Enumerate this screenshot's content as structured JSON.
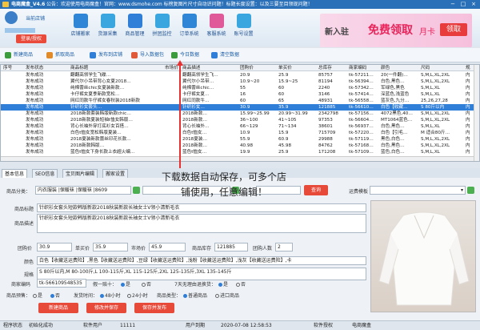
{
  "window": {
    "title": "电商魔盒_V4.6",
    "notice": "公告：欢迎使用电商魔盒！官网：www.dsmohe.com 标榜复图片尺寸自动识问题！标题长度设置：以及三要至目领现问题！",
    "controls": [
      "−",
      "□",
      "×"
    ]
  },
  "header": {
    "user_label": "当前店铺",
    "login_label": "登录/授权",
    "nav": [
      {
        "label": "店铺搬家",
        "icon": "shop-move-icon",
        "color": "#2f86d6"
      },
      {
        "label": "货源采集",
        "icon": "collect-icon",
        "color": "#3aa6e0"
      },
      {
        "label": "商品管理",
        "icon": "goods-icon",
        "color": "#2f7ed8"
      },
      {
        "label": "拼团监控",
        "icon": "monitor-icon",
        "color": "#3aa6e0"
      },
      {
        "label": "订单系统",
        "icon": "order-icon",
        "color": "#2f86d6"
      },
      {
        "label": "客服系统",
        "icon": "service-icon",
        "color": "#e05a9a"
      },
      {
        "label": "账号设置",
        "icon": "settings-icon",
        "color": "#3aa6e0"
      }
    ],
    "banner": {
      "prefix": "新入驻",
      "main": "免费领取",
      "suffix": "月卡",
      "button": "领取"
    }
  },
  "toolbar": [
    {
      "label": "新建商品",
      "icon": "add-icon",
      "color": "#3c9b3c"
    },
    {
      "label": "抓取商品",
      "icon": "grab-icon",
      "color": "#e08a2a"
    },
    {
      "label": "发布到店铺",
      "icon": "publish-icon",
      "color": "#2f7ed8"
    },
    {
      "label": "导入数据包",
      "icon": "import-icon",
      "color": "#e05a3a"
    },
    {
      "label": "今日数据",
      "icon": "today-icon",
      "color": "#3c9b3c"
    },
    {
      "label": "清空数据",
      "icon": "clear-icon",
      "color": "#2f7ed8"
    }
  ],
  "grid": {
    "columns": [
      "序号",
      "发布状态",
      "商品标题",
      "市场价",
      "商品描述",
      "团购价",
      "单买价",
      "总库存",
      "商家编码",
      "颜色",
      "尺码",
      "规"
    ],
    "rows": [
      [
        "",
        "发布成功",
        "翻翻高领学生飞碟…",
        "",
        "翻翻高领学生飞…",
        "20.9",
        "25.9",
        "85757",
        "tk-57211…",
        "20(一件翻)…",
        "S,M,L,XL,2XL",
        "内"
      ],
      [
        "",
        "发布成功",
        "翼代尔小吊带背心女夏2018…",
        "",
        "翼代尔小吊带…",
        "10.9~20",
        "15.9~25",
        "81194",
        "tk-56394…",
        "白色,黑色…",
        "S,M,L,XL,2XL",
        "内"
      ],
      [
        "",
        "发布成功",
        "纯棉蕾丝chic女夏装新款…",
        "",
        "纯棉蕾丝chic…",
        "55",
        "60",
        "2240",
        "tk-57342…",
        "军绿色,黑色",
        "S,M,L,XL",
        "内"
      ],
      [
        "",
        "发布成功",
        "卡仔裤女夏季新款宽松…",
        "",
        "卡仔裤女夏…",
        "16",
        "60",
        "3146",
        "tk-57414…",
        "深蓝色,浅蓝色",
        "S,M,L,XL",
        "内"
      ],
      [
        "",
        "发布成功",
        "网红同款牛仔裤女春秋装2018新款",
        "",
        "网红同款牛…",
        "60",
        "65",
        "48931",
        "tk-56558…",
        "蓝灰色,九分…",
        "25,26,27,28",
        "内"
      ],
      [
        "",
        "发布成功",
        "针织衫女套头…",
        "",
        "针织衫女…",
        "30.9",
        "35.9",
        "121885",
        "tk-56610…",
        "白色【收藏…",
        "S 80斤以内",
        "内"
      ],
      [
        "",
        "发布成功",
        "2018新款套装韩版新款chic…",
        "",
        "2018新款…",
        "15.99~25.99",
        "20.99~31.99",
        "2342798",
        "tk-57156…",
        "4072黑色,40…",
        "S,M,L,XL,2XL",
        "内"
      ],
      [
        "",
        "发布成功",
        "2018新款夏装短袖t恤女韩版…",
        "",
        "2018新款…",
        "36~100",
        "41~105",
        "97353",
        "tk-56604…",
        "MT1064蓝色…",
        "S,M,L,XL,2XL",
        "内"
      ],
      [
        "",
        "发布成功",
        "背心长袖外穿打底衫女百搭…",
        "",
        "背心长袖外…",
        "66~129",
        "71~134",
        "38601",
        "tk-56937…",
        "白色,黑色…",
        "S,M,L,XL",
        "内"
      ],
      [
        "",
        "发布成功",
        "白色t恤女宽松韩版夏装…",
        "",
        "白色t恤女…",
        "10.9",
        "15.9",
        "715709",
        "tk-57220…",
        "白色【引毛…",
        "M 适合80斤…",
        "内"
      ],
      [
        "",
        "发布成功",
        "2018夏装新款蕾丝印花长款…",
        "",
        "2018夏装…",
        "55.9",
        "60.9",
        "29988",
        "tk-57119…",
        "黑色,白色…",
        "S,M,L,XL,2XL",
        "内"
      ],
      [
        "",
        "发布成功",
        "2018新款韩版…",
        "",
        "2018新款…",
        "40.98",
        "45.98",
        "84762",
        "tk-57168…",
        "白色,黑色…",
        "S,M,L,XL,2XL",
        "内"
      ],
      [
        "",
        "发布成功",
        "蓝色t恤女下身长款上衣超火编…",
        "",
        "蓝色t恤女…",
        "19.9",
        "25.9",
        "171208",
        "tk-57109…",
        "蓝色,白色…",
        "S,M,L,XL",
        "内"
      ]
    ],
    "selected_index": 5
  },
  "tabs": [
    "基本信息",
    "SEO信息",
    "宝贝图片编辑",
    "搬家设置"
  ],
  "overlay_text": [
    "下载数据自动保存，可多个店",
    "铺使用，任意编辑！"
  ],
  "form": {
    "category_label": "商品分类：",
    "category_value": "内衣服装 |保暖袜 |保暖袜 |8609",
    "search_button": "查询",
    "template_label": "运费模板",
    "title_label": "商品标题",
    "title_value": "针织衫女套头短款韩版新款2018秋装新款长袖女士V领小清新毛衣",
    "desc_label": "商品描述",
    "desc_value": "针织衫女套头短款韩版新款2018秋装新款长袖女士V领小清新毛衣",
    "group_price_label": "团购价",
    "group_price": "30.9",
    "single_price_label": "单买价",
    "single_price": "35.9",
    "market_price_label": "市场价",
    "market_price": "45.9",
    "stock_label": "商品库存",
    "stock": "121885",
    "group_size_label": "团购人数",
    "group_size": "2",
    "color_label": "颜色",
    "color_value": "白色【收藏送运费险】,黑色【收藏送运费险】,豆绿【收藏送运费险】,浅粉【收藏送运费险】,浅灰【收藏送运费险】,卡",
    "spec_label": "规格",
    "spec_value": "S 80斤以内,M 80-100斤,L 100-115斤,XL 115-125斤,2XL 125-135斤,3XL 135-145斤",
    "code_label": "商家编码",
    "code_value": "tk-566109548535",
    "refund_label": "假一赔十：",
    "refund_yes": "是",
    "refund_no": "否",
    "seven_day_label": "7天无理由退换货：",
    "seven_yes": "是",
    "seven_no": "否",
    "preorder_label": "商品预售：",
    "preorder_yes": "是",
    "preorder_no": "否",
    "ship_label": "发货时间：",
    "ship_48": "48小时",
    "ship_24": "24小时",
    "type_label": "商品类型：",
    "type_normal": "普通商品",
    "type_import": "进口商品",
    "buttons": [
      "新建商品",
      "修改并保存",
      "保存并发布"
    ]
  },
  "status": {
    "state_label": "程序状态",
    "state_value": "初始化成功",
    "user_label": "软件用户",
    "user_value": "11111",
    "expire_label": "用户到期",
    "expire_value": "2020-07-08 12:58:53",
    "auth_label": "软件授权",
    "auth_value": "电商魔盒"
  }
}
